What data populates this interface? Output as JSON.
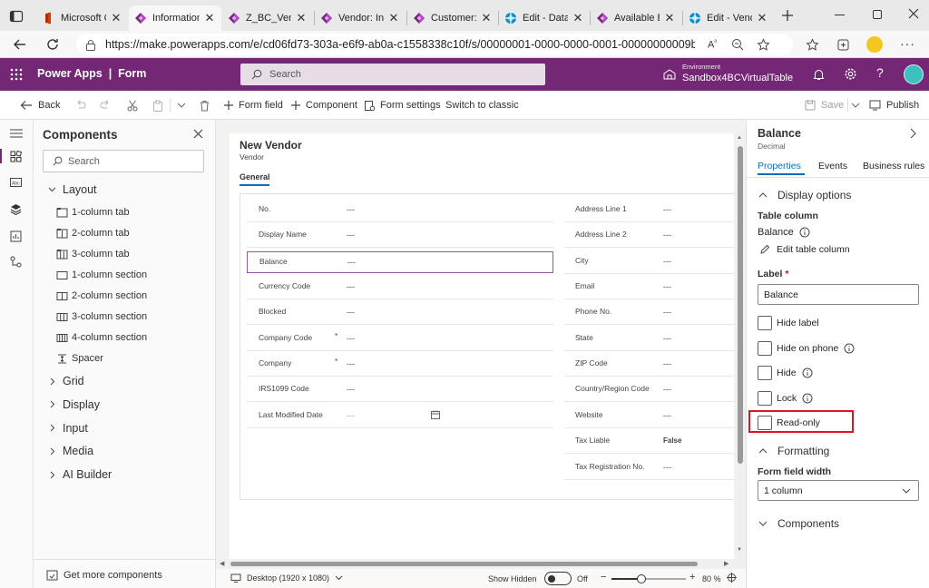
{
  "browser": {
    "tabs": [
      {
        "label": "Microsoft C",
        "favicon": "office-icon"
      },
      {
        "label": "Information",
        "favicon": "powerapps-icon",
        "active": true
      },
      {
        "label": "Z_BC_Vend",
        "favicon": "powerapps-icon"
      },
      {
        "label": "Vendor: Inf",
        "favicon": "powerapps-icon"
      },
      {
        "label": "Customer: I",
        "favicon": "powerapps-icon"
      },
      {
        "label": "Edit - Datav",
        "favicon": "dataverse-icon"
      },
      {
        "label": "Available B",
        "favicon": "powerapps-icon"
      },
      {
        "label": "Edit - Vend",
        "favicon": "dataverse-icon"
      }
    ],
    "url": "https://make.powerapps.com/e/cd06fd73-303a-e6f9-ab0a-c1558338c10f/s/00000001-0000-0000-0001-00000000009b/entity/dyn3..."
  },
  "header": {
    "app_title": "Power Apps  |  Form",
    "search_placeholder": "Search",
    "env_label": "Environment",
    "env_name": "Sandbox4BCVirtualTable"
  },
  "commandbar": {
    "back": "Back",
    "form_field": "Form field",
    "component": "Component",
    "form_settings": "Form settings",
    "switch_classic": "Switch to classic",
    "save": "Save",
    "publish": "Publish"
  },
  "components": {
    "title": "Components",
    "search_placeholder": "Search",
    "layout_label": "Layout",
    "layout_items": [
      "1-column tab",
      "2-column tab",
      "3-column tab",
      "1-column section",
      "2-column section",
      "3-column section",
      "4-column section",
      "Spacer"
    ],
    "groups": [
      "Grid",
      "Display",
      "Input",
      "Media",
      "AI Builder"
    ],
    "get_more": "Get more components"
  },
  "form": {
    "title": "New Vendor",
    "subtitle": "Vendor",
    "tab": "General",
    "left_fields": [
      {
        "label": "No.",
        "value": "---"
      },
      {
        "label": "Display Name",
        "value": "---"
      },
      {
        "label": "Balance",
        "value": "---",
        "selected": true
      },
      {
        "label": "Currency Code",
        "value": "---"
      },
      {
        "label": "Blocked",
        "value": "---"
      },
      {
        "label": "Company Code",
        "value": "---",
        "required": true
      },
      {
        "label": "Company",
        "value": "---",
        "required": true
      },
      {
        "label": "IRS1099 Code",
        "value": "---"
      },
      {
        "label": "Last Modified Date",
        "value": "---",
        "calendar": true
      }
    ],
    "right_fields": [
      {
        "label": "Address Line 1",
        "value": "---"
      },
      {
        "label": "Address Line 2",
        "value": "---"
      },
      {
        "label": "City",
        "value": "---"
      },
      {
        "label": "Email",
        "value": "---"
      },
      {
        "label": "Phone No.",
        "value": "---"
      },
      {
        "label": "State",
        "value": "---"
      },
      {
        "label": "ZIP Code",
        "value": "---"
      },
      {
        "label": "Country/Region Code",
        "value": "---"
      },
      {
        "label": "Website",
        "value": "---"
      },
      {
        "label": "Tax Liable",
        "value": "False"
      },
      {
        "label": "Tax Registration No.",
        "value": "---"
      }
    ],
    "required_mark": "*"
  },
  "bottombar": {
    "viewport": "Desktop (1920 x 1080)",
    "show_hidden": "Show Hidden",
    "toggle_state": "Off",
    "zoom": "80 %",
    "zoom_fraction": 0.4
  },
  "properties": {
    "field_title": "Balance",
    "field_type": "Decimal",
    "tabs": [
      "Properties",
      "Events",
      "Business rules"
    ],
    "display_options": "Display options",
    "table_column_label": "Table column",
    "table_column_value": "Balance",
    "edit_table_column": "Edit table column",
    "label_label": "Label",
    "label_value": "Balance",
    "required_mark": "*",
    "checkboxes": [
      "Hide label",
      "Hide on phone",
      "Hide",
      "Lock",
      "Read-only"
    ],
    "formatting": "Formatting",
    "form_field_width": "Form field width",
    "width_value": "1 column",
    "components_section": "Components"
  },
  "colors": {
    "brand": "#742774",
    "accent": "#0f6cbd",
    "highlight": "#e81123"
  }
}
